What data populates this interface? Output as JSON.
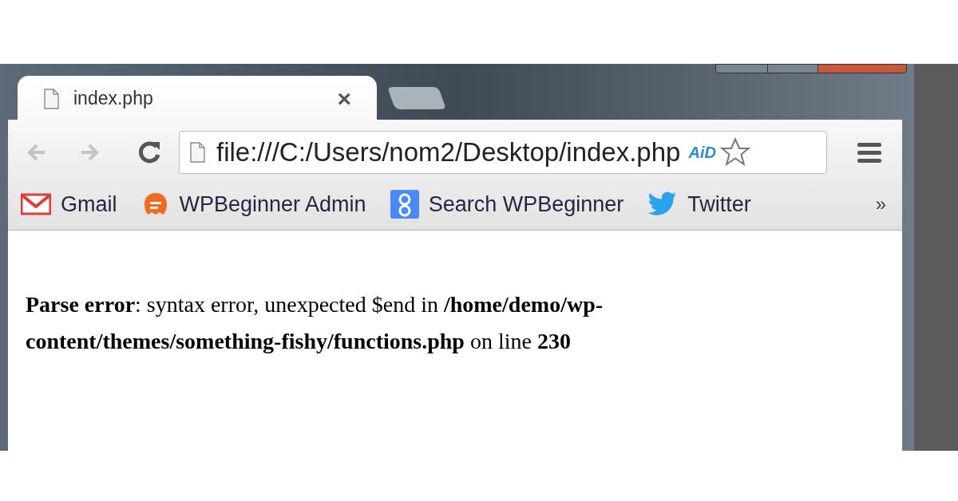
{
  "tabs": [
    {
      "title": "index.php",
      "close": "×",
      "selected": true
    },
    {
      "selected": false
    }
  ],
  "toolbar": {
    "back_disabled": true,
    "forward_disabled": true,
    "address": "file:///C:/Users/nom2/Desktop/index.php",
    "extension_label": "AiD",
    "bookmarked": false
  },
  "bookmarks": [
    {
      "label": "Gmail",
      "kind": "gmail"
    },
    {
      "label": "WPBeginner Admin",
      "kind": "wpb"
    },
    {
      "label": "Search WPBeginner",
      "kind": "google"
    },
    {
      "label": "Twitter",
      "kind": "twitter"
    }
  ],
  "bookmarks_overflow": "»",
  "page": {
    "error": "**Parse error**: syntax error, unexpected $end in **/home/demo/wp-content/themes/something-fishy/functions.php** on line **230**"
  }
}
